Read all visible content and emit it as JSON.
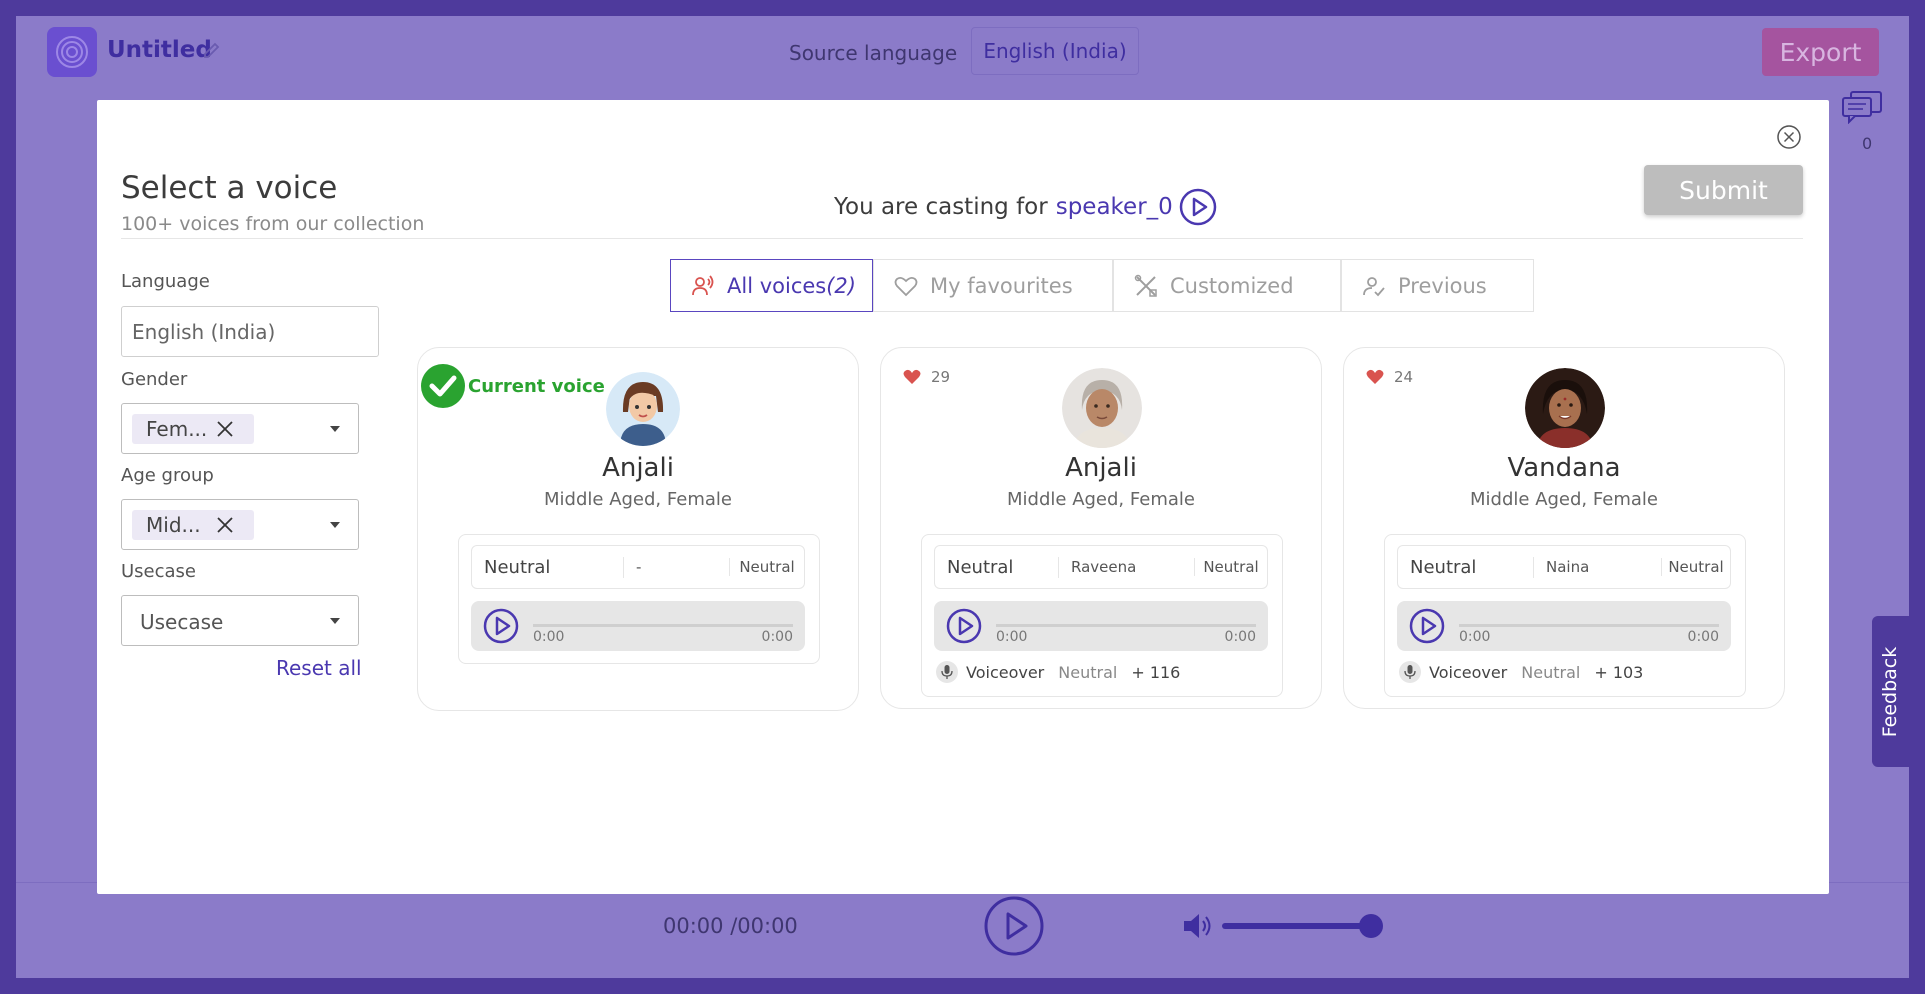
{
  "app": {
    "project_title": "Untitled",
    "source_language_label": "Source language",
    "source_language_value": "English (India)",
    "export_label": "Export",
    "comments_count": "0",
    "player_time": "00:00 /00:00",
    "feedback_label": "Feedback"
  },
  "modal": {
    "title": "Select a voice",
    "subtitle": "100+ voices from our collection",
    "casting_prefix": "You are casting for",
    "speaker": "speaker_0",
    "submit_label": "Submit"
  },
  "filters": {
    "language_label": "Language",
    "language_value": "English (India)",
    "gender_label": "Gender",
    "gender_chip": "Fem...",
    "age_label": "Age group",
    "age_chip": "Mid...",
    "usecase_label": "Usecase",
    "usecase_placeholder": "Usecase",
    "reset_label": "Reset all"
  },
  "tabs": [
    {
      "label": "All voices",
      "count": "(2)"
    },
    {
      "label": "My favourites",
      "count": ""
    },
    {
      "label": "Customized",
      "count": ""
    },
    {
      "label": "Previous",
      "count": ""
    }
  ],
  "current_voice_label": "Current voice",
  "voices": [
    {
      "name": "Anjali",
      "meta": "Middle Aged, Female",
      "favourites": "",
      "tone": "Neutral",
      "speaker": "-",
      "style": "Neutral",
      "time_start": "0:00",
      "time_end": "0:00",
      "tag1": "",
      "tag2": "",
      "more": ""
    },
    {
      "name": "Anjali",
      "meta": "Middle Aged, Female",
      "favourites": "29",
      "tone": "Neutral",
      "speaker": "Raveena",
      "style": "Neutral",
      "time_start": "0:00",
      "time_end": "0:00",
      "tag1": "Voiceover",
      "tag2": "Neutral",
      "more": "+ 116"
    },
    {
      "name": "Vandana",
      "meta": "Middle Aged, Female",
      "favourites": "24",
      "tone": "Neutral",
      "speaker": "Naina",
      "style": "Neutral",
      "time_start": "0:00",
      "time_end": "0:00",
      "tag1": "Voiceover",
      "tag2": "Neutral",
      "more": "+ 103"
    }
  ],
  "colors": {
    "accent": "#4a38b0",
    "overlay": "#8b7bc9",
    "current_voice": "#2aa330",
    "heart": "#d9534f"
  }
}
